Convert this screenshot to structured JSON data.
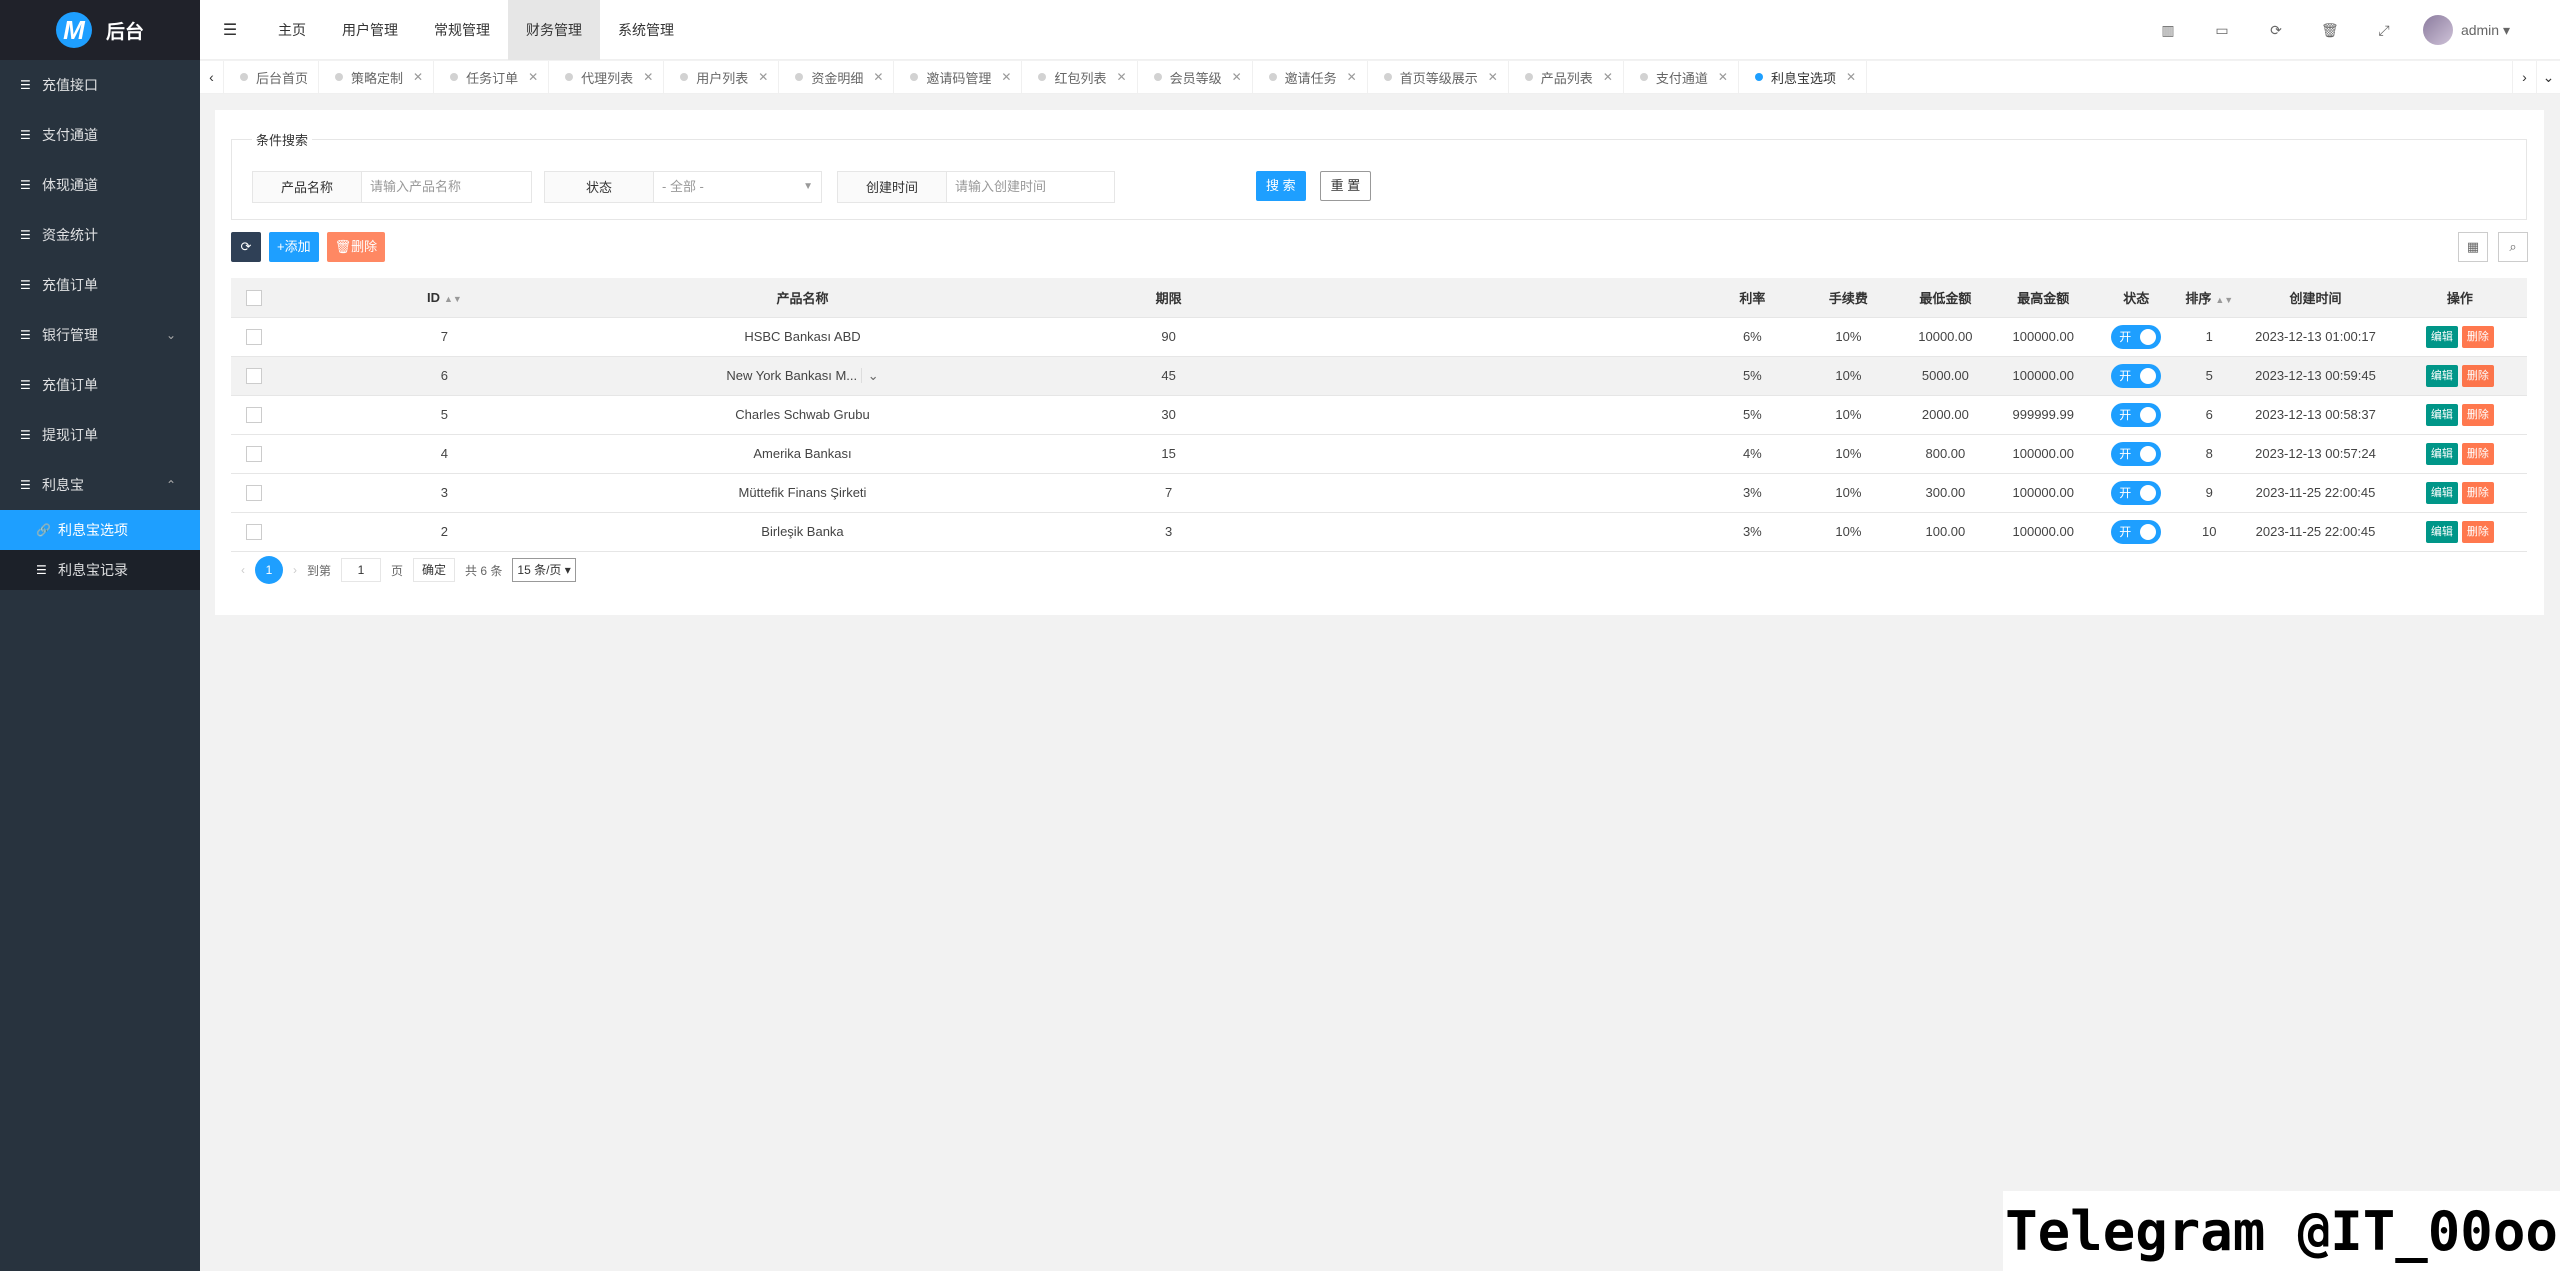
{
  "brand": {
    "logo": "M",
    "title": "后台"
  },
  "sidebar": {
    "items": [
      {
        "label": "充值接口"
      },
      {
        "label": "支付通道"
      },
      {
        "label": "体现通道"
      },
      {
        "label": "资金统计"
      },
      {
        "label": "充值订单"
      },
      {
        "label": "银行管理"
      },
      {
        "label": "充值订单"
      },
      {
        "label": "提现订单"
      },
      {
        "label": "利息宝"
      }
    ],
    "sub": [
      {
        "label": "利息宝选项"
      },
      {
        "label": "利息宝记录"
      }
    ]
  },
  "topnav": [
    "主页",
    "用户管理",
    "常规管理",
    "财务管理",
    "系统管理"
  ],
  "user": {
    "name": "admin"
  },
  "tabs": [
    "后台首页",
    "策略定制",
    "任务订单",
    "代理列表",
    "用户列表",
    "资金明细",
    "邀请码管理",
    "红包列表",
    "会员等级",
    "邀请任务",
    "首页等级展示",
    "产品列表",
    "支付通道",
    "利息宝选项"
  ],
  "search": {
    "legend": "条件搜索",
    "product_label": "产品名称",
    "product_ph": "请输入产品名称",
    "status_label": "状态",
    "status_val": "- 全部 -",
    "time_label": "创建时间",
    "time_ph": "请输入创建时间",
    "search_btn": "搜 索",
    "reset_btn": "重 置"
  },
  "toolbar": {
    "add": "添加",
    "del": "删除"
  },
  "table": {
    "headers": [
      "ID",
      "产品名称",
      "期限",
      "利率",
      "手续费",
      "最低金额",
      "最高金额",
      "状态",
      "排序",
      "创建时间",
      "操作"
    ],
    "rows": [
      {
        "id": "7",
        "name": "HSBC Bankası ABD",
        "term": "90",
        "rate": "6%",
        "fee": "10%",
        "min": "10000.00",
        "max": "100000.00",
        "status": "开",
        "sort": "1",
        "time": "2023-12-13 01:00:17"
      },
      {
        "id": "6",
        "name": "New York Bankası M...",
        "term": "45",
        "rate": "5%",
        "fee": "10%",
        "min": "5000.00",
        "max": "100000.00",
        "status": "开",
        "sort": "5",
        "time": "2023-12-13 00:59:45"
      },
      {
        "id": "5",
        "name": "Charles Schwab Grubu",
        "term": "30",
        "rate": "5%",
        "fee": "10%",
        "min": "2000.00",
        "max": "999999.99",
        "status": "开",
        "sort": "6",
        "time": "2023-12-13 00:58:37"
      },
      {
        "id": "4",
        "name": "Amerika Bankası",
        "term": "15",
        "rate": "4%",
        "fee": "10%",
        "min": "800.00",
        "max": "100000.00",
        "status": "开",
        "sort": "8",
        "time": "2023-12-13 00:57:24"
      },
      {
        "id": "3",
        "name": "Müttefik Finans Şirketi",
        "term": "7",
        "rate": "3%",
        "fee": "10%",
        "min": "300.00",
        "max": "100000.00",
        "status": "开",
        "sort": "9",
        "time": "2023-11-25 22:00:45"
      },
      {
        "id": "2",
        "name": "Birleşik Banka",
        "term": "3",
        "rate": "3%",
        "fee": "10%",
        "min": "100.00",
        "max": "100000.00",
        "status": "开",
        "sort": "10",
        "time": "2023-11-25 22:00:45"
      }
    ],
    "edit": "编辑",
    "delete": "删除"
  },
  "pager": {
    "page": "1",
    "goto": "到第",
    "page_unit": "页",
    "confirm": "确定",
    "total": "共 6 条",
    "size": "15 条/页"
  },
  "watermark": "Telegram @IT_00oo"
}
